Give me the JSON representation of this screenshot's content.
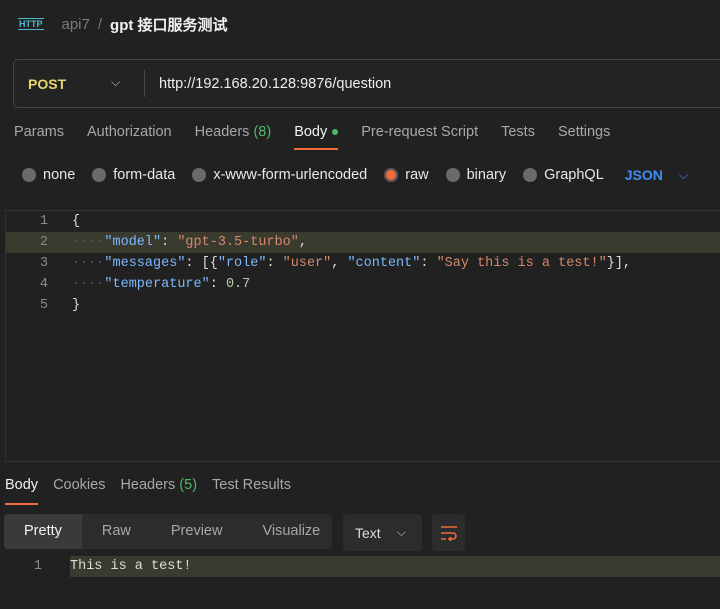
{
  "breadcrumb": {
    "icon": "http-icon",
    "icon_text": "HTTP",
    "parent": "api7",
    "separator": "/",
    "title": "gpt 接口服务测试"
  },
  "request": {
    "method": "POST",
    "url": "http://192.168.20.128:9876/question"
  },
  "tabs": [
    {
      "label": "Params"
    },
    {
      "label": "Authorization"
    },
    {
      "label": "Headers",
      "count": "(8)"
    },
    {
      "label": "Body",
      "active": true
    },
    {
      "label": "Pre-request Script"
    },
    {
      "label": "Tests"
    },
    {
      "label": "Settings"
    }
  ],
  "body_types": [
    {
      "label": "none"
    },
    {
      "label": "form-data"
    },
    {
      "label": "x-www-form-urlencoded"
    },
    {
      "label": "raw",
      "selected": true
    },
    {
      "label": "binary"
    },
    {
      "label": "GraphQL"
    }
  ],
  "raw_format": "JSON",
  "code_lines": [
    {
      "n": "1",
      "tokens": [
        [
          "p",
          "{"
        ]
      ]
    },
    {
      "n": "2",
      "tokens": [
        [
          "ws",
          "····"
        ],
        [
          "k",
          "\"model\""
        ],
        [
          "p",
          ": "
        ],
        [
          "s",
          "\"gpt-3.5-turbo\""
        ],
        [
          "p",
          ","
        ]
      ]
    },
    {
      "n": "3",
      "tokens": [
        [
          "ws",
          "····"
        ],
        [
          "k",
          "\"messages\""
        ],
        [
          "p",
          ": [{"
        ],
        [
          "k",
          "\"role\""
        ],
        [
          "p",
          ": "
        ],
        [
          "s",
          "\"user\""
        ],
        [
          "p",
          ", "
        ],
        [
          "k",
          "\"content\""
        ],
        [
          "p",
          ": "
        ],
        [
          "s",
          "\"Say this is a test!\""
        ],
        [
          "p",
          "}],"
        ]
      ]
    },
    {
      "n": "4",
      "tokens": [
        [
          "ws",
          "····"
        ],
        [
          "k",
          "\"temperature\""
        ],
        [
          "p",
          ": "
        ],
        [
          "n",
          "0.7"
        ]
      ]
    },
    {
      "n": "5",
      "tokens": [
        [
          "p",
          "}"
        ]
      ]
    }
  ],
  "response": {
    "tabs": [
      {
        "label": "Body",
        "active": true
      },
      {
        "label": "Cookies"
      },
      {
        "label": "Headers",
        "count": "(5)"
      },
      {
        "label": "Test Results"
      }
    ],
    "views": [
      "Pretty",
      "Raw",
      "Preview",
      "Visualize"
    ],
    "format": "Text",
    "lines": [
      {
        "n": "1",
        "text": "This is a test!"
      }
    ]
  },
  "colors": {
    "accent": "#f26b3a",
    "method": "#ead56d",
    "json": "#3f8ef5",
    "count": "#4cb96b"
  }
}
